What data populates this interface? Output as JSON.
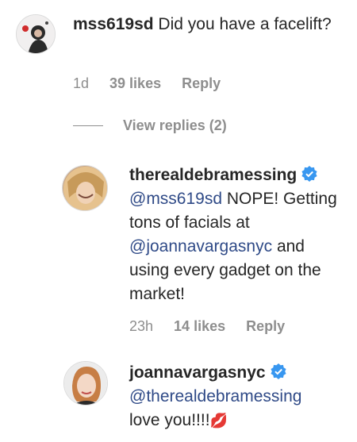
{
  "comments": [
    {
      "username": "mss619sd",
      "text": "Did you have a facelift?",
      "time": "1d",
      "likes": "39 likes",
      "reply": "Reply",
      "verified": false
    },
    {
      "username": "therealdebramessing",
      "mention1": "@mss619sd",
      "text_part1": "NOPE! Getting tons of facials at",
      "mention2": "@joannavargasnyc",
      "text_part2": "and using every gadget on the market!",
      "time": "23h",
      "likes": "14 likes",
      "reply": "Reply",
      "verified": true
    },
    {
      "username": "joannavargasnyc",
      "mention1": "@therealdebramessing",
      "text": "love you!!!!",
      "emoji": "💋",
      "verified": true
    }
  ],
  "view_replies": "View replies (2)",
  "colors": {
    "verified": "#3897f0",
    "mention": "#2f4a87",
    "meta": "#8e8e8e"
  }
}
